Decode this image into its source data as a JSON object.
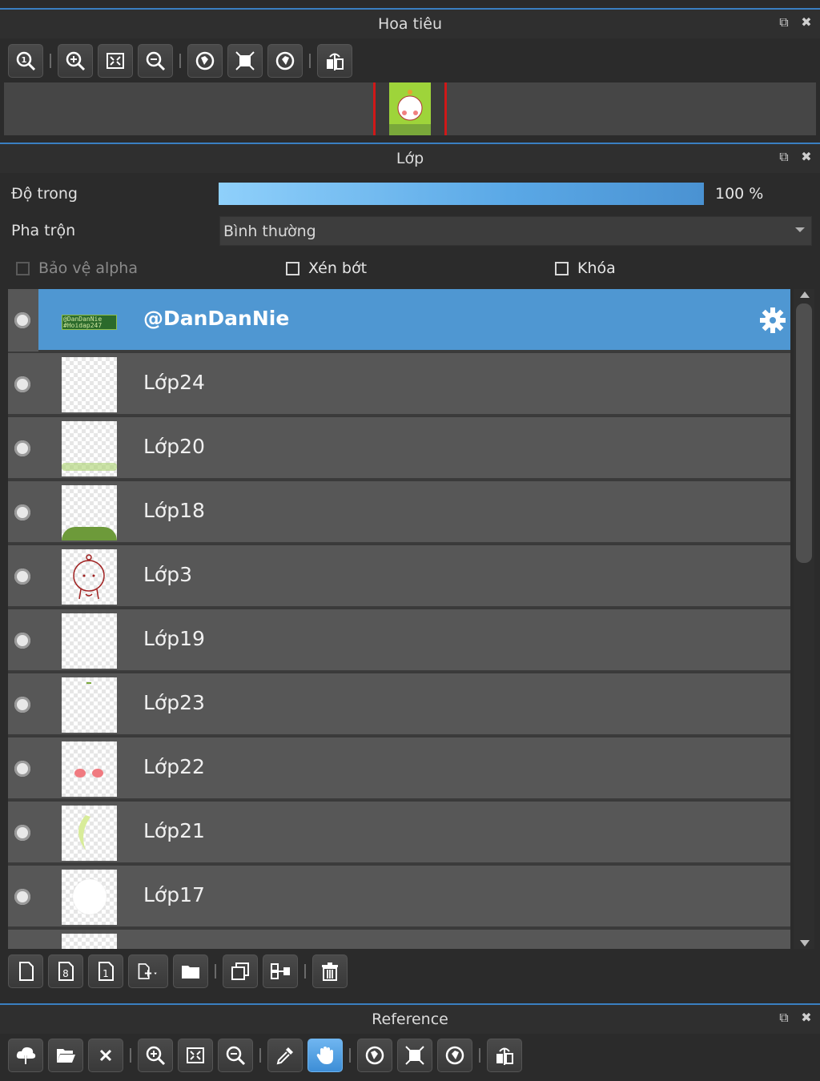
{
  "navigator": {
    "title": "Hoa tiêu",
    "toolbar": [
      "zoom-actual-icon",
      "zoom-in-icon",
      "fit-screen-icon",
      "zoom-out-icon",
      "rotate-left-icon",
      "fit-canvas-icon",
      "rotate-right-icon",
      "flip-horizontal-icon"
    ]
  },
  "layers_panel": {
    "title": "Lớp",
    "opacity_label": "Độ trong",
    "opacity_value": "100 %",
    "opacity": 1.0,
    "blend_label": "Pha trộn",
    "blend_mode": "Bình thường",
    "protect_alpha_label": "Bảo vệ alpha",
    "clipping_label": "Xén bớt",
    "lock_label": "Khóa",
    "layers": [
      {
        "name": "@DanDanNie",
        "selected": true
      },
      {
        "name": "Lớp24"
      },
      {
        "name": "Lớp20"
      },
      {
        "name": "Lớp18"
      },
      {
        "name": "Lớp3"
      },
      {
        "name": "Lớp19"
      },
      {
        "name": "Lớp23"
      },
      {
        "name": "Lớp22"
      },
      {
        "name": "Lớp21"
      },
      {
        "name": "Lớp17"
      }
    ],
    "thumb_text_line1": "@DanDanNie",
    "thumb_text_line2": "#Hoidap247",
    "toolbar": [
      "new-layer-icon",
      "new-8bit-layer-icon",
      "new-1bit-layer-icon",
      "add-layer-menu-icon",
      "new-folder-icon",
      "duplicate-layer-icon",
      "merge-down-icon",
      "delete-layer-icon"
    ]
  },
  "reference_panel": {
    "title": "Reference",
    "toolbar": [
      "open-cloud-icon",
      "open-folder-icon",
      "close-icon",
      "zoom-in-icon",
      "fit-screen-icon",
      "zoom-out-icon",
      "eyedropper-icon",
      "hand-icon",
      "rotate-left-icon",
      "fit-canvas-icon",
      "rotate-right-icon",
      "flip-horizontal-icon"
    ]
  },
  "colors": {
    "accent": "#4f97d2",
    "header_line": "#3a7fc2",
    "preview_border": "#d01818"
  }
}
